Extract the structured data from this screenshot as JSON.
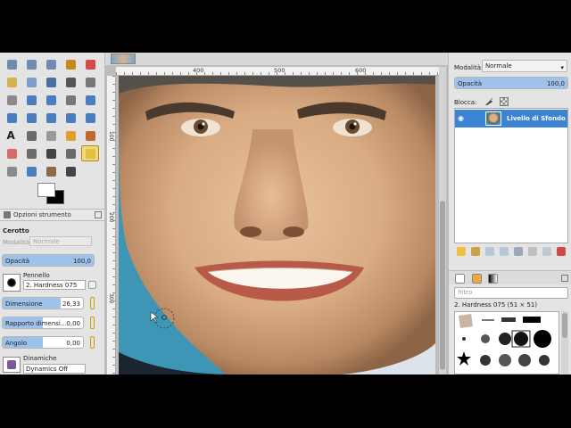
{
  "toolbox": {
    "tools": [
      {
        "name": "rect-select",
        "color": "#6f8bb0"
      },
      {
        "name": "ellipse-select",
        "color": "#6f8bb0"
      },
      {
        "name": "free-select",
        "color": "#6f8bb0"
      },
      {
        "name": "fuzzy-select",
        "color": "#c48a1e"
      },
      {
        "name": "by-color-select",
        "color": "#d24d4d"
      },
      {
        "name": "scissors-select",
        "color": "#d2b34d"
      },
      {
        "name": "foreground-select",
        "color": "#7aa0c8"
      },
      {
        "name": "paths",
        "color": "#4c6fa0"
      },
      {
        "name": "color-picker",
        "color": "#555555"
      },
      {
        "name": "zoom",
        "color": "#777777"
      },
      {
        "name": "measure",
        "color": "#8a8a8a"
      },
      {
        "name": "move",
        "color": "#4c7dbf"
      },
      {
        "name": "align",
        "color": "#4c7dbf"
      },
      {
        "name": "crop",
        "color": "#777777"
      },
      {
        "name": "rotate",
        "color": "#4c7dbf"
      },
      {
        "name": "scale",
        "color": "#4c7dbf"
      },
      {
        "name": "shear",
        "color": "#4c7dbf"
      },
      {
        "name": "perspective",
        "color": "#4c7dbf"
      },
      {
        "name": "flip",
        "color": "#4c7dbf"
      },
      {
        "name": "cage-transform",
        "color": "#4c7dbf"
      },
      {
        "name": "text",
        "color": "#111111"
      },
      {
        "name": "bucket-fill",
        "color": "#6b6b6b"
      },
      {
        "name": "blend",
        "color": "#9a9a9a"
      },
      {
        "name": "pencil",
        "color": "#e0a030"
      },
      {
        "name": "paintbrush",
        "color": "#c06a30"
      },
      {
        "name": "eraser",
        "color": "#d96a6a"
      },
      {
        "name": "airbrush",
        "color": "#6a6a6a"
      },
      {
        "name": "ink",
        "color": "#444444"
      },
      {
        "name": "clone",
        "color": "#6a6a6a"
      },
      {
        "name": "heal",
        "color": "#e0c040"
      },
      {
        "name": "perspective-clone",
        "color": "#8a8a8a"
      },
      {
        "name": "blur-sharpen",
        "color": "#4c7dbf"
      },
      {
        "name": "smudge",
        "color": "#8a6a4a"
      },
      {
        "name": "dodge-burn",
        "color": "#444444"
      }
    ],
    "active_tool_index": 29,
    "colors": {
      "foreground": "#ffffff",
      "background": "#000000"
    }
  },
  "tool_options": {
    "tab_title": "Opzioni strumento",
    "tool_name": "Cerotto",
    "mode_label": "Modalità",
    "mode_value": "Normale",
    "opacity": {
      "label": "Opacità",
      "value": "100,0",
      "fraction": 1.0
    },
    "brush": {
      "label": "Pennello",
      "value": "2. Hardness 075"
    },
    "size": {
      "label": "Dimensione",
      "value": "26,33",
      "fraction": 0.72
    },
    "aspect": {
      "label": "Rapporto dimensi...",
      "value": "0,00",
      "fraction": 0.5
    },
    "angle": {
      "label": "Angolo",
      "value": "0,00",
      "fraction": 0.5
    },
    "dynamics": {
      "label": "Dinamiche",
      "value": "Dynamics Off"
    }
  },
  "canvas": {
    "ruler_labels": [
      "400",
      "500",
      "600"
    ],
    "vruler_labels": [
      "100",
      "200",
      "300"
    ]
  },
  "dock": {
    "mode_label": "Modalità:",
    "mode_value": "Normale",
    "opacity": {
      "label": "Opacità",
      "value": "100,0",
      "fraction": 1.0
    },
    "lock_label": "Blocca:",
    "layer_name": "Livello di Sfondo",
    "filter_placeholder": "filtro",
    "brush_name": "2. Hardness 075 (51 × 51)"
  }
}
